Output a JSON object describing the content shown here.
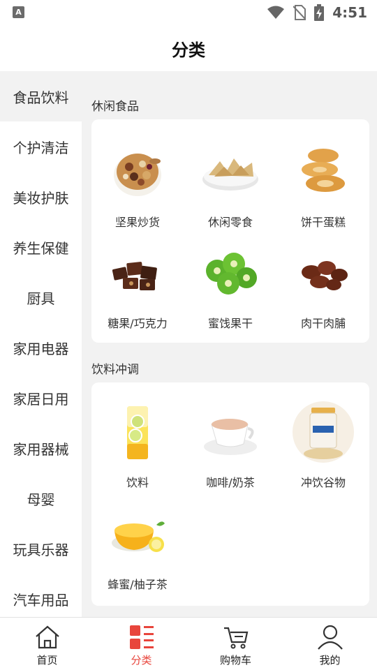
{
  "status_bar": {
    "left_icon": "A",
    "time": "4:51",
    "icons": [
      "wifi-icon",
      "no-sim-icon",
      "battery-charging-icon"
    ]
  },
  "header": {
    "title": "分类"
  },
  "sidebar": {
    "items": [
      {
        "label": "食品饮料",
        "active": true
      },
      {
        "label": "个护清洁"
      },
      {
        "label": "美妆护肤"
      },
      {
        "label": "养生保健"
      },
      {
        "label": "厨具"
      },
      {
        "label": "家用电器"
      },
      {
        "label": "家居日用"
      },
      {
        "label": "家用器械"
      },
      {
        "label": "母婴"
      },
      {
        "label": "玩具乐器"
      },
      {
        "label": "汽车用品"
      }
    ]
  },
  "main": {
    "sections": [
      {
        "title": "休闲食品",
        "items": [
          {
            "label": "坚果炒货",
            "icon": "nuts-image"
          },
          {
            "label": "休闲零食",
            "icon": "chips-image"
          },
          {
            "label": "饼干蛋糕",
            "icon": "cookies-image"
          },
          {
            "label": "糖果/巧克力",
            "icon": "chocolate-image"
          },
          {
            "label": "蜜饯果干",
            "icon": "dried-kiwi-image"
          },
          {
            "label": "肉干肉脯",
            "icon": "jerky-image"
          }
        ]
      },
      {
        "title": "饮料冲调",
        "items": [
          {
            "label": "饮料",
            "icon": "drink-image"
          },
          {
            "label": "咖啡/奶茶",
            "icon": "coffee-image"
          },
          {
            "label": "冲饮谷物",
            "icon": "oatmeal-image"
          },
          {
            "label": "蜂蜜/柚子茶",
            "icon": "honey-image"
          }
        ]
      }
    ]
  },
  "bottom_nav": {
    "items": [
      {
        "label": "首页",
        "icon": "home-icon"
      },
      {
        "label": "分类",
        "icon": "category-icon",
        "active": true
      },
      {
        "label": "购物车",
        "icon": "cart-icon"
      },
      {
        "label": "我的",
        "icon": "profile-icon"
      }
    ]
  },
  "colors": {
    "accent": "#e8453c",
    "background": "#f2f2f2"
  }
}
